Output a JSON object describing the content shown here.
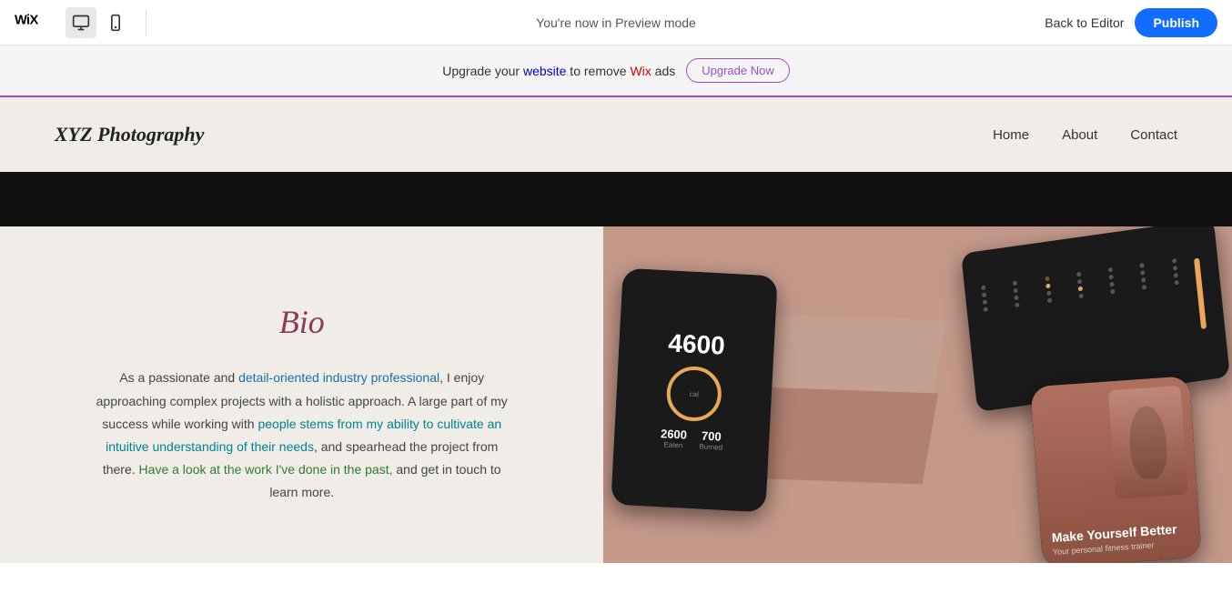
{
  "topbar": {
    "logo": "Wix",
    "preview_text": "You're now in Preview mode",
    "back_label": "Back to Editor",
    "publish_label": "Publish",
    "device_desktop_title": "Desktop view",
    "device_mobile_title": "Mobile view"
  },
  "banner": {
    "text_before": "Upgrade your ",
    "text_website": "website",
    "text_middle": " to remove ",
    "text_wix": "Wix",
    "text_after": " ads",
    "button_label": "Upgrade Now"
  },
  "site_header": {
    "logo": "XYZ Photography",
    "nav": {
      "home": "Home",
      "about": "About",
      "contact": "Contact"
    }
  },
  "bio_section": {
    "title": "Bio",
    "paragraph": "As a passionate and detail-oriented industry professional, I enjoy approaching complex projects with a holistic approach. A large part of my success while working with people stems from my ability to cultivate an intuitive understanding of their needs, and spearhead the project from there. Have a look at the work I've done in the past, and get in touch to learn more."
  },
  "image_section": {
    "alt_text": "App screenshots on pink/brown 3D boxes"
  },
  "calories": {
    "main": "4600",
    "sub1_val": "2600",
    "sub1_label": "Eaten",
    "sub2_val": "700",
    "sub2_label": "Burned"
  },
  "fitness": {
    "headline": "Make Yourself Better",
    "subline": "Your personal fitness trainer"
  },
  "colors": {
    "publish_bg": "#116dff",
    "upgrade_border": "#9b4dca",
    "bio_title": "#8b3a5a",
    "panel_bg": "#f0ede8"
  }
}
